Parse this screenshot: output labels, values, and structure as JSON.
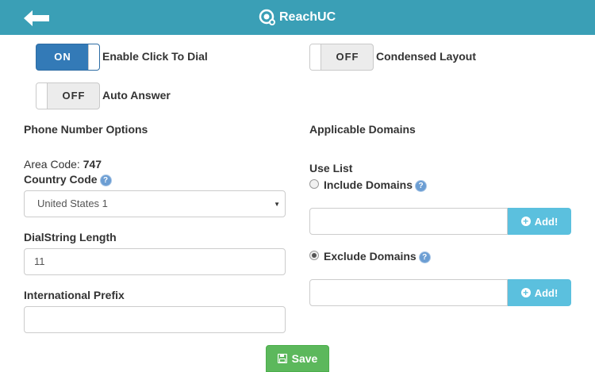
{
  "header": {
    "brand_name": "ReachUC",
    "color": "#3a9fb6"
  },
  "toggles": {
    "click_to_dial": {
      "state": "ON",
      "label": "Enable Click To Dial"
    },
    "condensed_layout": {
      "state": "OFF",
      "label": "Condensed Layout"
    },
    "auto_answer": {
      "state": "OFF",
      "label": "Auto Answer"
    }
  },
  "phone_options": {
    "heading": "Phone Number Options",
    "area_code_label": "Area Code:",
    "area_code_value": "747",
    "country_code_label": "Country Code",
    "country_code_selected": "United States 1",
    "dialstring_label": "DialString Length",
    "dialstring_value": "11",
    "intl_prefix_label": "International Prefix",
    "intl_prefix_value": ""
  },
  "domains": {
    "heading": "Applicable Domains",
    "use_list_label": "Use List",
    "include_label": "Include Domains",
    "exclude_label": "Exclude Domains",
    "selected": "exclude",
    "include_input_value": "",
    "exclude_input_value": "",
    "add_label": "Add!"
  },
  "help_icon_glyph": "?",
  "save_label": "Save",
  "colors": {
    "primary": "#337ab7",
    "info": "#5bc0de",
    "success": "#5cb85c"
  }
}
